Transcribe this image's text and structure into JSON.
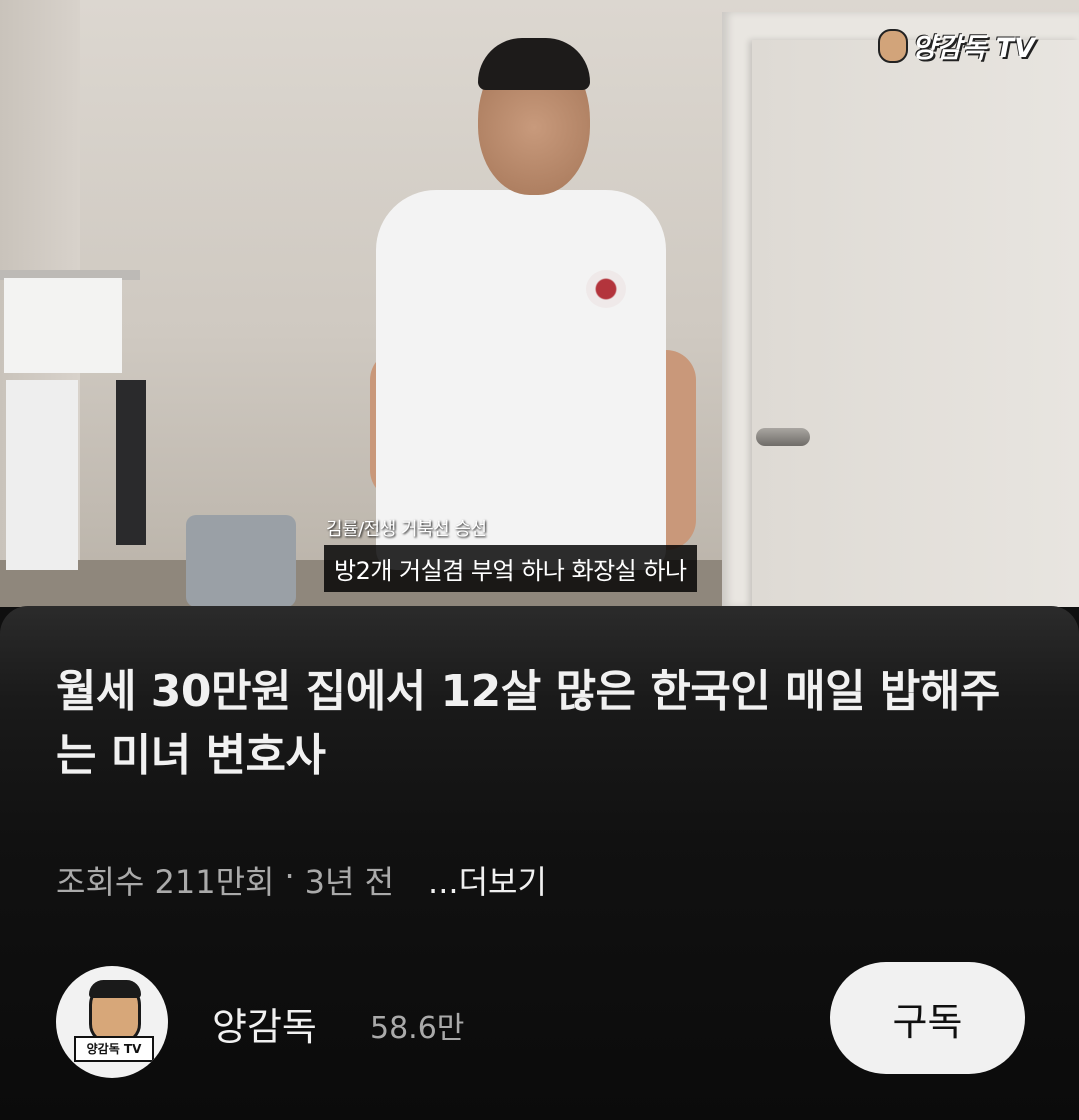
{
  "video": {
    "watermark": "양감독 TV",
    "caption_speaker": "김률/전생 거북선 승선",
    "caption_text": "방2개 거실겸 부엌 하나 화장실 하나"
  },
  "details": {
    "title": "월세 30만원 집에서 12살 많은 한국인 매일 밥해주는 미녀 변호사",
    "views": "조회수 211만회",
    "separator": "·",
    "age": "3년 전",
    "more_label": "...더보기"
  },
  "channel": {
    "name": "양감독",
    "subscribers": "58.6만",
    "avatar_tag": "양감독 TV",
    "subscribe_label": "구독"
  }
}
